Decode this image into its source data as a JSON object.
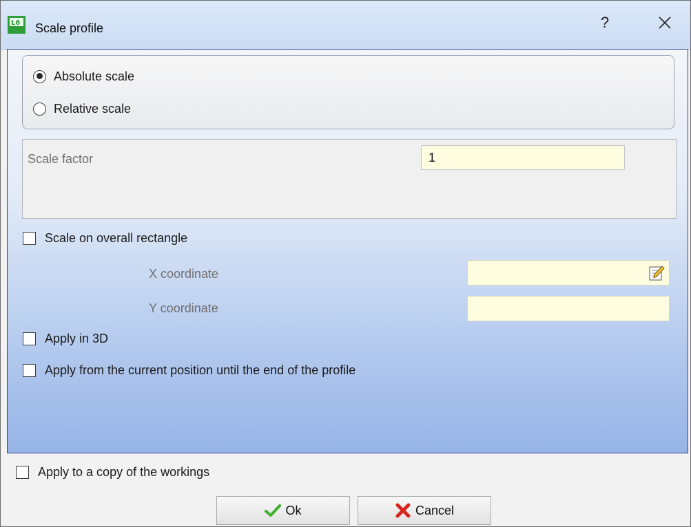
{
  "window": {
    "title": "Scale profile",
    "help_label": "?"
  },
  "scale_mode": {
    "options": [
      {
        "label": "Absolute scale",
        "selected": true
      },
      {
        "label": "Relative scale",
        "selected": false
      }
    ]
  },
  "scale_factor": {
    "label": "Scale factor",
    "value": "1"
  },
  "overall_rectangle": {
    "label": "Scale on overall rectangle",
    "checked": false,
    "x_label": "X coordinate",
    "x_value": "",
    "y_label": "Y coordinate",
    "y_value": ""
  },
  "options": {
    "apply_3d": {
      "label": "Apply in 3D",
      "checked": false
    },
    "apply_from_current": {
      "label": "Apply from the current position until the end of the profile",
      "checked": false
    },
    "apply_copy": {
      "label": "Apply to a copy of the workings",
      "checked": false
    }
  },
  "buttons": {
    "ok": "Ok",
    "cancel": "Cancel"
  },
  "icons": {
    "app": "app-icon",
    "help": "help-icon",
    "close": "close-icon",
    "edit": "edit-icon",
    "ok": "checkmark-icon",
    "cancel": "cross-icon"
  },
  "colors": {
    "input_background": "#fffde0",
    "client_gradient_bottom": "#96b4e6",
    "ok_green": "#3fae2a",
    "cancel_red": "#d8261c"
  }
}
